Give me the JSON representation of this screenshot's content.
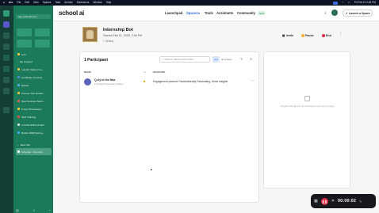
{
  "menubar": {
    "items": [
      "Arc",
      "File",
      "Edit",
      "View",
      "Spaces",
      "Tabs",
      "Archive",
      "Extensions",
      "Window",
      "Help"
    ],
    "clock": "Fri Feb 21 2:46 PM"
  },
  "browser_sidebar": {
    "url": "app.schoolai.com",
    "items": [
      {
        "label": "Unti",
        "color": "#f5c542"
      },
      {
        "label": "My Content",
        "color": "#c8d7f0"
      },
      {
        "label": "Launch Kalturo Co...",
        "color": "#f5c542"
      },
      {
        "label": "Certificate Generat...",
        "color": "#4f8de0"
      },
      {
        "label": "Dictios",
        "color": "#5fa8f0"
      },
      {
        "label": "Canvas Test Guides",
        "color": "#f3c13a"
      },
      {
        "label": "New Success Sand...",
        "color": "#e85a4f"
      },
      {
        "label": "Power BI Features",
        "color": "#ffcb2f"
      },
      {
        "label": "HEA Training",
        "color": "#e44c4c"
      },
      {
        "label": "COVID ABTM 2L1ET",
        "color": "#d9dfe8"
      },
      {
        "label": "BLDG 480R Spring...",
        "color": "#3ca6ff"
      }
    ],
    "new_tab": "New Tab",
    "active_tab": "Schoolai - Internsh..."
  },
  "topnav": {
    "logo": "school ai",
    "links": [
      "Launchpad",
      "Spaces",
      "Tools",
      "Assistants",
      "Community"
    ],
    "new_badge": "New",
    "launch_label": "Launch a Space"
  },
  "space": {
    "title": "Internship Bot",
    "started": "Started Feb 21, 2025, 2:46 PM",
    "setting": "Setting",
    "invite": "Invite",
    "pause": "Pause",
    "end": "End"
  },
  "participants": {
    "title": "1 Participant",
    "search_placeholder": "Search names and chats",
    "sort_label": "A-Z",
    "groups_label": "Groups",
    "col_name": "NAME",
    "col_headline": "HEADLINE",
    "rows": [
      {
        "name": "Q-rly to the Max",
        "meta": "0 minutes 8 seconds minutes",
        "headline": "Engagement present: Fascinationally Fascinating, Great insights"
      }
    ]
  },
  "insights": {
    "empty_text": "Insights will appear as participants join and engage."
  },
  "recorder": {
    "time": "00:00:02"
  }
}
